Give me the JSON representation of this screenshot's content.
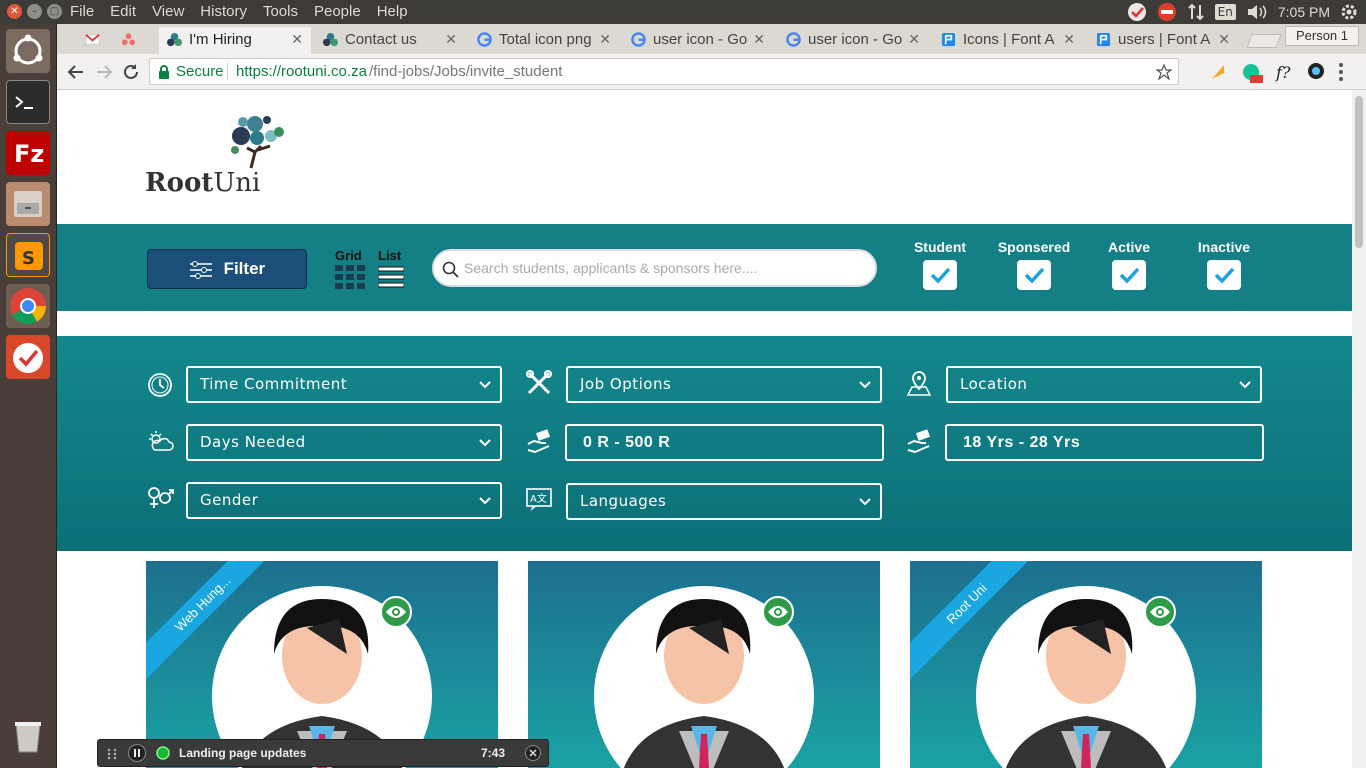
{
  "system": {
    "menus": [
      "File",
      "Edit",
      "View",
      "History",
      "Tools",
      "People",
      "Help"
    ],
    "keyboard": "En",
    "time": "7:05 PM"
  },
  "tabs": [
    {
      "label": "",
      "icon": "gmail-icon"
    },
    {
      "label": "",
      "icon": "asana-icon"
    },
    {
      "label": "I'm Hiring",
      "icon": "rootuni-icon"
    },
    {
      "label": "Contact us",
      "icon": "rootuni-icon"
    },
    {
      "label": "Total icon png",
      "icon": "google-icon"
    },
    {
      "label": "user icon - Go",
      "icon": "google-icon"
    },
    {
      "label": "user icon - Go",
      "icon": "google-icon"
    },
    {
      "label": "Icons | Font A",
      "icon": "fontawesome-icon"
    },
    {
      "label": "users | Font A",
      "icon": "fontawesome-icon"
    }
  ],
  "profile": "Person 1",
  "address": {
    "secure": "Secure",
    "url_host": "https://rootuni.co.za",
    "url_path": "/find-jobs/Jobs/invite_student"
  },
  "logo": {
    "text_root": "Root",
    "text_uni": "Uni"
  },
  "filterbar": {
    "filter_label": "Filter",
    "grid_label": "Grid",
    "list_label": "List",
    "search_placeholder": "Search students, applicants & sponsors here....",
    "checkboxes": [
      {
        "label": "Student",
        "checked": true
      },
      {
        "label": "Sponsered",
        "checked": true
      },
      {
        "label": "Active",
        "checked": true
      },
      {
        "label": "Inactive",
        "checked": true
      }
    ]
  },
  "filters": {
    "time_commitment": "Time Commitment",
    "job_options": "Job Options",
    "location": "Location",
    "days_needed": "Days Needed",
    "salary_range": "0 R - 500 R",
    "age_range": "18 Yrs - 28 Yrs",
    "gender": "Gender",
    "languages": "Languages"
  },
  "cards": [
    {
      "ribbon": "Web Hung..."
    },
    {
      "ribbon": ""
    },
    {
      "ribbon": "Root Uni"
    }
  ],
  "notification": {
    "title": "Landing page updates",
    "time": "7:43"
  },
  "colors": {
    "teal": "#147f85",
    "filter_btn": "#1b4f79",
    "eye_green": "#2f9a4a",
    "ribbon": "#1aa6e0"
  }
}
